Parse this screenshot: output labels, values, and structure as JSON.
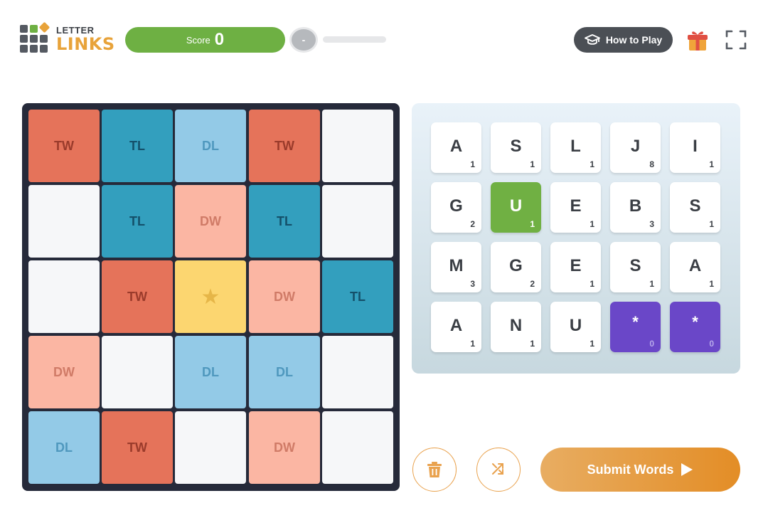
{
  "logo": {
    "line1": "LETTER",
    "line2": "LINKS"
  },
  "score": {
    "label": "Score",
    "value": "0"
  },
  "level": {
    "indicator": "-",
    "progress": 0
  },
  "header": {
    "how_to_play_label": "How to Play",
    "how_to_play_icon": "graduation-cap-icon",
    "gift_icon": "gift-icon",
    "fullscreen_icon": "fullscreen-icon"
  },
  "board": {
    "rows": [
      [
        {
          "type": "tw",
          "label": "TW"
        },
        {
          "type": "tl",
          "label": "TL"
        },
        {
          "type": "dl",
          "label": "DL"
        },
        {
          "type": "tw",
          "label": "TW"
        },
        {
          "type": "blank",
          "label": ""
        }
      ],
      [
        {
          "type": "blank",
          "label": ""
        },
        {
          "type": "tl",
          "label": "TL"
        },
        {
          "type": "dw",
          "label": "DW"
        },
        {
          "type": "tl",
          "label": "TL"
        },
        {
          "type": "blank",
          "label": ""
        }
      ],
      [
        {
          "type": "blank",
          "label": ""
        },
        {
          "type": "tw",
          "label": "TW"
        },
        {
          "type": "star",
          "label": "★"
        },
        {
          "type": "dw",
          "label": "DW"
        },
        {
          "type": "tl",
          "label": "TL"
        }
      ],
      [
        {
          "type": "dw",
          "label": "DW"
        },
        {
          "type": "blank",
          "label": ""
        },
        {
          "type": "dl",
          "label": "DL"
        },
        {
          "type": "dl",
          "label": "DL"
        },
        {
          "type": "blank",
          "label": ""
        }
      ],
      [
        {
          "type": "dl",
          "label": "DL"
        },
        {
          "type": "tw",
          "label": "TW"
        },
        {
          "type": "blank",
          "label": ""
        },
        {
          "type": "dw",
          "label": "DW"
        },
        {
          "type": "blank",
          "label": ""
        }
      ]
    ]
  },
  "rack": {
    "rows": [
      [
        {
          "letter": "A",
          "points": "1",
          "state": "normal"
        },
        {
          "letter": "S",
          "points": "1",
          "state": "normal"
        },
        {
          "letter": "L",
          "points": "1",
          "state": "normal"
        },
        {
          "letter": "J",
          "points": "8",
          "state": "normal"
        },
        {
          "letter": "I",
          "points": "1",
          "state": "normal"
        }
      ],
      [
        {
          "letter": "G",
          "points": "2",
          "state": "normal"
        },
        {
          "letter": "U",
          "points": "1",
          "state": "selected"
        },
        {
          "letter": "E",
          "points": "1",
          "state": "normal"
        },
        {
          "letter": "B",
          "points": "3",
          "state": "normal"
        },
        {
          "letter": "S",
          "points": "1",
          "state": "normal"
        }
      ],
      [
        {
          "letter": "M",
          "points": "3",
          "state": "normal"
        },
        {
          "letter": "G",
          "points": "2",
          "state": "normal"
        },
        {
          "letter": "E",
          "points": "1",
          "state": "normal"
        },
        {
          "letter": "S",
          "points": "1",
          "state": "normal"
        },
        {
          "letter": "A",
          "points": "1",
          "state": "normal"
        }
      ],
      [
        {
          "letter": "A",
          "points": "1",
          "state": "normal"
        },
        {
          "letter": "N",
          "points": "1",
          "state": "normal"
        },
        {
          "letter": "U",
          "points": "1",
          "state": "normal"
        },
        {
          "letter": "*",
          "points": "0",
          "state": "blank"
        },
        {
          "letter": "*",
          "points": "0",
          "state": "blank"
        }
      ]
    ]
  },
  "actions": {
    "trash_icon": "trash-icon",
    "shuffle_icon": "shuffle-icon",
    "submit_label": "Submit Words",
    "submit_icon": "play-arrow-icon"
  },
  "colors": {
    "tw": "#e5735a",
    "tl": "#339fbe",
    "dl": "#93cae7",
    "dw": "#fbb6a3",
    "star": "#fcd670",
    "selected": "#70b043",
    "blank_tile": "#6a47c8",
    "accent": "#e38d26",
    "score_green": "#6eb043"
  }
}
